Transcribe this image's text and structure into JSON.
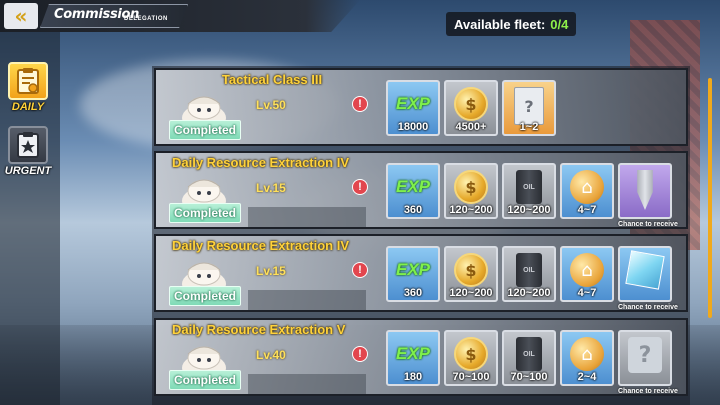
{
  "header": {
    "back_icon": "double-chevron-left-icon",
    "title": "Commission",
    "subtitle": "DELEGATION"
  },
  "fleet": {
    "label": "Available fleet:",
    "value": "0/4"
  },
  "sidebar": {
    "items": [
      {
        "label": "DAILY",
        "icon": "clipboard-check-icon",
        "active": true
      },
      {
        "label": "URGENT",
        "icon": "star-clipboard-icon",
        "active": false
      }
    ]
  },
  "commissions": [
    {
      "title": "Tactical Class III",
      "level": "Lv.50",
      "status": "Completed",
      "alert": "!",
      "rewards": [
        {
          "type": "exp",
          "icon": "exp-icon",
          "icon_text": "EXP",
          "value": "18000",
          "style": "blue"
        },
        {
          "type": "coin",
          "icon": "coin-icon",
          "value": "4500+",
          "style": "gray"
        },
        {
          "type": "book",
          "icon": "skill-book-icon",
          "value": "1~2",
          "style": "gold"
        }
      ]
    },
    {
      "title": "Daily Resource Extraction IV",
      "level": "Lv.15",
      "status": "Completed",
      "alert": "!",
      "chance": "Chance to receive",
      "rewards": [
        {
          "type": "exp",
          "icon": "exp-icon",
          "icon_text": "EXP",
          "value": "360",
          "style": "blue"
        },
        {
          "type": "coin",
          "icon": "coin-icon",
          "value": "120~200",
          "style": "gray"
        },
        {
          "type": "oil",
          "icon": "oil-barrel-icon",
          "icon_text": "OIL",
          "value": "120~200",
          "style": "gray"
        },
        {
          "type": "house",
          "icon": "dorm-icon",
          "value": "4~7",
          "style": "blue"
        },
        {
          "type": "drill",
          "icon": "drill-icon",
          "value": "",
          "style": "purple"
        }
      ]
    },
    {
      "title": "Daily Resource Extraction IV",
      "level": "Lv.15",
      "status": "Completed",
      "alert": "!",
      "chance": "Chance to receive",
      "rewards": [
        {
          "type": "exp",
          "icon": "exp-icon",
          "icon_text": "EXP",
          "value": "360",
          "style": "blue"
        },
        {
          "type": "coin",
          "icon": "coin-icon",
          "value": "120~200",
          "style": "gray"
        },
        {
          "type": "oil",
          "icon": "oil-barrel-icon",
          "icon_text": "OIL",
          "value": "120~200",
          "style": "gray"
        },
        {
          "type": "house",
          "icon": "dorm-icon",
          "value": "4~7",
          "style": "blue"
        },
        {
          "type": "cube",
          "icon": "cube-icon",
          "value": "",
          "style": "blue"
        }
      ]
    },
    {
      "title": "Daily Resource Extraction  V",
      "level": "Lv.40",
      "status": "Completed",
      "alert": "!",
      "chance": "Chance to receive",
      "rewards": [
        {
          "type": "exp",
          "icon": "exp-icon",
          "icon_text": "EXP",
          "value": "180",
          "style": "blue"
        },
        {
          "type": "coin",
          "icon": "coin-icon",
          "value": "70~100",
          "style": "gray"
        },
        {
          "type": "oil",
          "icon": "oil-barrel-icon",
          "icon_text": "OIL",
          "value": "70~100",
          "style": "gray"
        },
        {
          "type": "house",
          "icon": "dorm-icon",
          "value": "2~4",
          "style": "blue"
        },
        {
          "type": "unknown",
          "icon": "question-mark-icon",
          "icon_text": "?",
          "value": "",
          "style": "gray"
        }
      ]
    }
  ]
}
